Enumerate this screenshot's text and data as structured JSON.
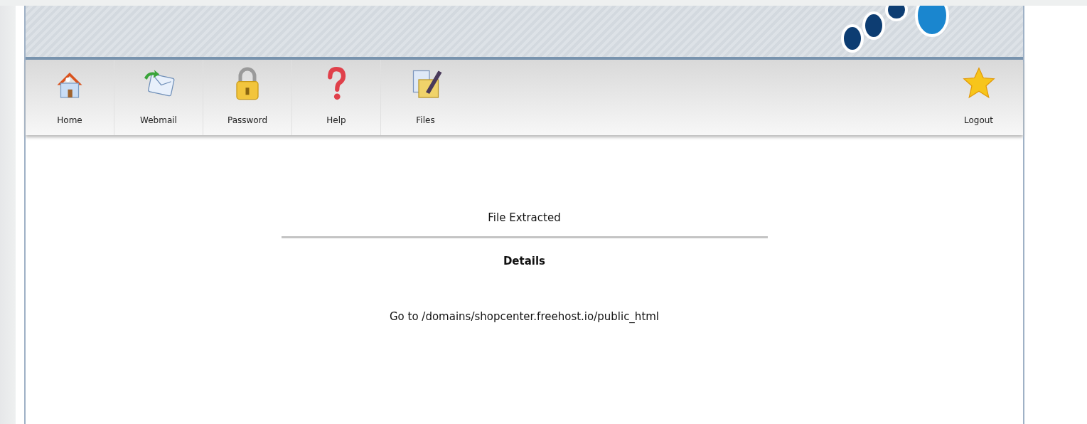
{
  "toolbar": {
    "items": [
      {
        "label": "Home"
      },
      {
        "label": "Webmail"
      },
      {
        "label": "Password"
      },
      {
        "label": "Help"
      },
      {
        "label": "Files"
      }
    ],
    "right_item": {
      "label": "Logout"
    }
  },
  "message": {
    "title": "File Extracted",
    "heading": "Details",
    "text": "Go to /domains/shopcenter.freehost.io/public_html"
  }
}
